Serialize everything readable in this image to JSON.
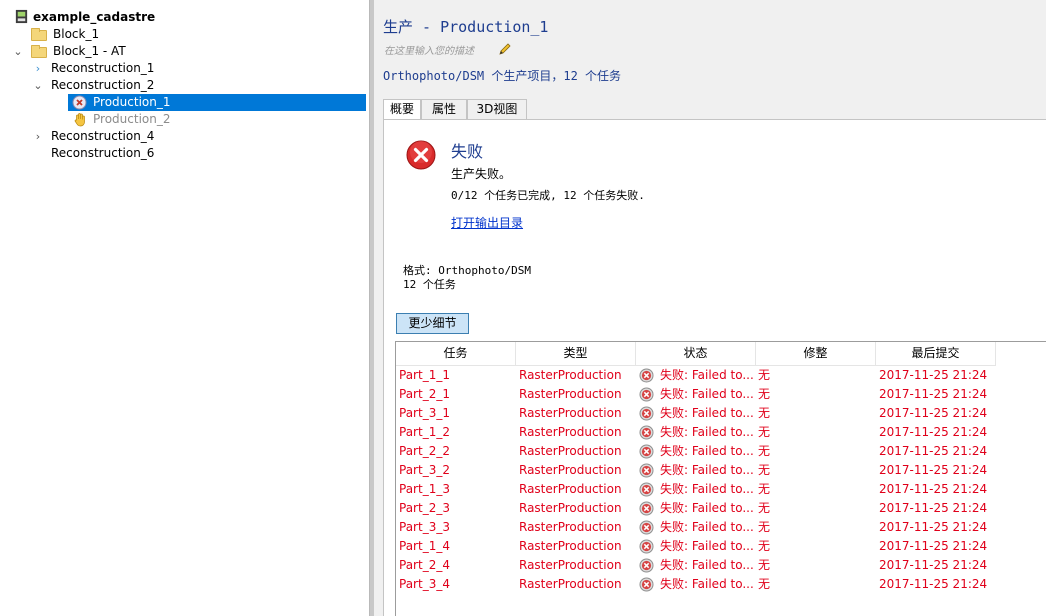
{
  "tree": {
    "root": {
      "label": "example_cadastre"
    },
    "items": [
      {
        "label": "Block_1"
      },
      {
        "label": "Block_1 - AT"
      },
      {
        "label": "Reconstruction_1"
      },
      {
        "label": "Reconstruction_2"
      },
      {
        "label": "Production_1"
      },
      {
        "label": "Production_2"
      },
      {
        "label": "Reconstruction_4"
      },
      {
        "label": "Reconstruction_6"
      }
    ]
  },
  "header": {
    "title": "生产 - Production_1",
    "description_placeholder": "在这里输入您的描述",
    "summary": "Orthophoto/DSM 个生产项目，12 个任务"
  },
  "tabs": [
    {
      "label": "概要"
    },
    {
      "label": "属性"
    },
    {
      "label": "3D视图"
    }
  ],
  "status": {
    "title": "失败",
    "message": "生产失败。",
    "count": "0/12 个任务已完成, 12 个任务失败.",
    "open_output": "打开输出目录"
  },
  "info": {
    "format": "格式: Orthophoto/DSM",
    "tasks": "12 个任务"
  },
  "less_details_label": "更少细节",
  "table": {
    "headers": [
      "任务",
      "类型",
      "状态",
      "修整",
      "最后提交"
    ],
    "rows": [
      {
        "task": "Part_1_1",
        "type": "RasterProduction",
        "status": "失败: Failed to...",
        "trim": "无",
        "last": "2017-11-25 21:24"
      },
      {
        "task": "Part_2_1",
        "type": "RasterProduction",
        "status": "失败: Failed to...",
        "trim": "无",
        "last": "2017-11-25 21:24"
      },
      {
        "task": "Part_3_1",
        "type": "RasterProduction",
        "status": "失败: Failed to...",
        "trim": "无",
        "last": "2017-11-25 21:24"
      },
      {
        "task": "Part_1_2",
        "type": "RasterProduction",
        "status": "失败: Failed to...",
        "trim": "无",
        "last": "2017-11-25 21:24"
      },
      {
        "task": "Part_2_2",
        "type": "RasterProduction",
        "status": "失败: Failed to...",
        "trim": "无",
        "last": "2017-11-25 21:24"
      },
      {
        "task": "Part_3_2",
        "type": "RasterProduction",
        "status": "失败: Failed to...",
        "trim": "无",
        "last": "2017-11-25 21:24"
      },
      {
        "task": "Part_1_3",
        "type": "RasterProduction",
        "status": "失败: Failed to...",
        "trim": "无",
        "last": "2017-11-25 21:24"
      },
      {
        "task": "Part_2_3",
        "type": "RasterProduction",
        "status": "失败: Failed to...",
        "trim": "无",
        "last": "2017-11-25 21:24"
      },
      {
        "task": "Part_3_3",
        "type": "RasterProduction",
        "status": "失败: Failed to...",
        "trim": "无",
        "last": "2017-11-25 21:24"
      },
      {
        "task": "Part_1_4",
        "type": "RasterProduction",
        "status": "失败: Failed to...",
        "trim": "无",
        "last": "2017-11-25 21:24"
      },
      {
        "task": "Part_2_4",
        "type": "RasterProduction",
        "status": "失败: Failed to...",
        "trim": "无",
        "last": "2017-11-25 21:24"
      },
      {
        "task": "Part_3_4",
        "type": "RasterProduction",
        "status": "失败: Failed to...",
        "trim": "无",
        "last": "2017-11-25 21:24"
      }
    ]
  },
  "colors": {
    "error": "#e0001a",
    "selection": "#0078d7",
    "title_blue": "#1e3d8f",
    "link": "#0033cc"
  }
}
